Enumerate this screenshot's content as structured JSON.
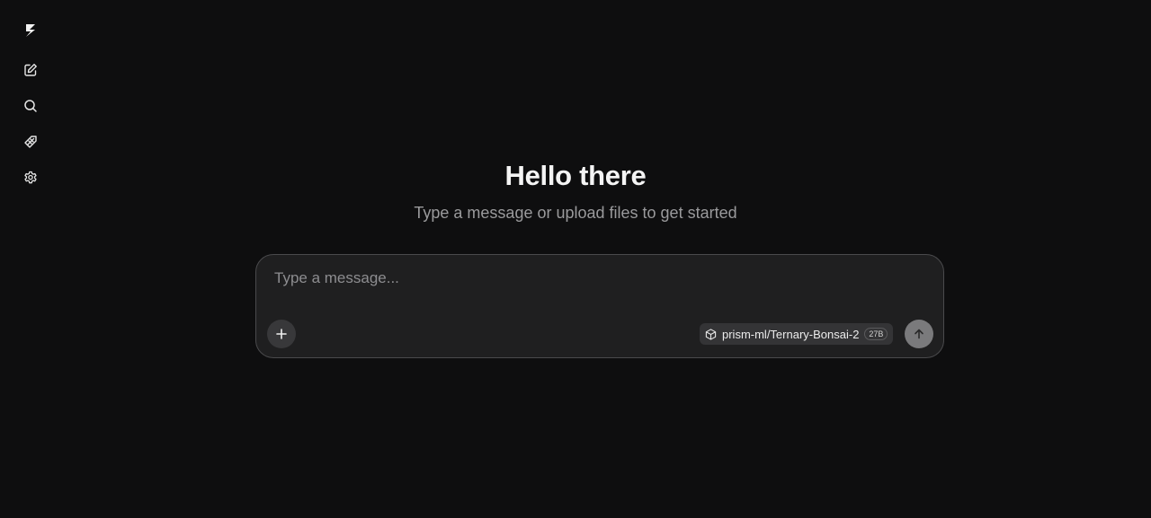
{
  "sidebar": {
    "items": [
      {
        "icon": "logo-icon"
      },
      {
        "icon": "new-chat-icon"
      },
      {
        "icon": "search-icon"
      },
      {
        "icon": "models-icon"
      },
      {
        "icon": "gear-icon"
      }
    ]
  },
  "hero": {
    "title": "Hello there",
    "subtitle": "Type a message or upload files to get started"
  },
  "composer": {
    "placeholder": "Type a message...",
    "value": "",
    "model_name": "prism-ml/Ternary-Bonsai-2",
    "model_size": "27B"
  },
  "colors": {
    "background": "#0e0e0f",
    "composer_bg": "#1f1f20",
    "composer_border": "#4a4a4c",
    "send_button": "#7a7a7c"
  }
}
